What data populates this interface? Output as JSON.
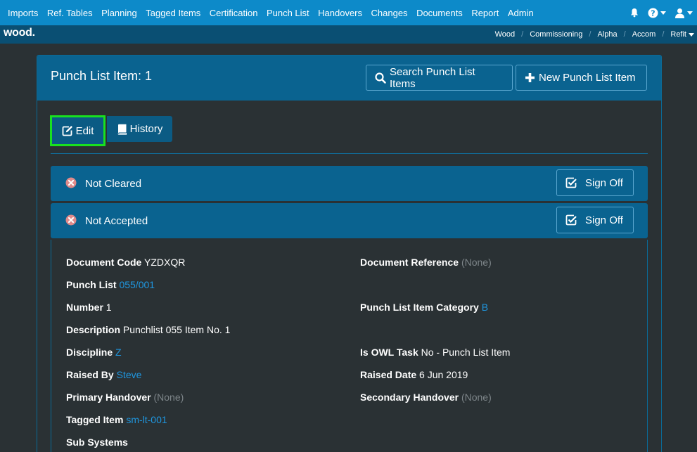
{
  "topnav": {
    "items": [
      "Imports",
      "Ref. Tables",
      "Planning",
      "Tagged Items",
      "Certification",
      "Punch List",
      "Handovers",
      "Changes",
      "Documents",
      "Report",
      "Admin"
    ]
  },
  "subbar": {
    "logo": "wood.",
    "breadcrumbs": [
      "Wood",
      "Commissioning",
      "Alpha",
      "Accom",
      "Refit"
    ]
  },
  "panel": {
    "title": "Punch List Item: 1",
    "search_label": "Search Punch List Items",
    "new_label": "New Punch List Item",
    "edit_label": "Edit",
    "history_label": "History"
  },
  "statuses": [
    {
      "text": "Not Cleared",
      "action": "Sign Off"
    },
    {
      "text": "Not Accepted",
      "action": "Sign Off"
    }
  ],
  "details": {
    "document_code": {
      "label": "Document Code",
      "value": "YZDXQR"
    },
    "document_reference": {
      "label": "Document Reference",
      "value": "(None)"
    },
    "punch_list": {
      "label": "Punch List",
      "value": "055/001"
    },
    "number": {
      "label": "Number",
      "value": "1"
    },
    "punch_list_item_category": {
      "label": "Punch List Item Category",
      "value": "B"
    },
    "description": {
      "label": "Description",
      "value": "Punchlist 055 Item No. 1"
    },
    "discipline": {
      "label": "Discipline",
      "value": "Z"
    },
    "is_owl_task": {
      "label": "Is OWL Task",
      "value": "No - Punch List Item"
    },
    "raised_by": {
      "label": "Raised By",
      "value": "Steve"
    },
    "raised_date": {
      "label": "Raised Date",
      "value": "6 Jun 2019"
    },
    "primary_handover": {
      "label": "Primary Handover",
      "value": "(None)"
    },
    "secondary_handover": {
      "label": "Secondary Handover",
      "value": "(None)"
    },
    "tagged_item": {
      "label": "Tagged Item",
      "value": "sm-lt-001"
    },
    "sub_systems": {
      "label": "Sub Systems",
      "value": ""
    }
  },
  "icons": {
    "bell": "bell-icon",
    "help": "question-circle-icon",
    "user": "user-icon",
    "search": "search-icon",
    "plus": "plus-icon",
    "edit": "edit-icon",
    "history": "book-icon",
    "status": "times-circle-icon",
    "signoff": "check-square-icon"
  },
  "colors": {
    "topnav": "#0d8ac9",
    "subbar": "#0a4f73",
    "panel_header": "#0a6390",
    "background": "#2a3134",
    "link": "#1f97e0",
    "highlight": "#19e11f",
    "status_icon": "#e08a8a"
  }
}
